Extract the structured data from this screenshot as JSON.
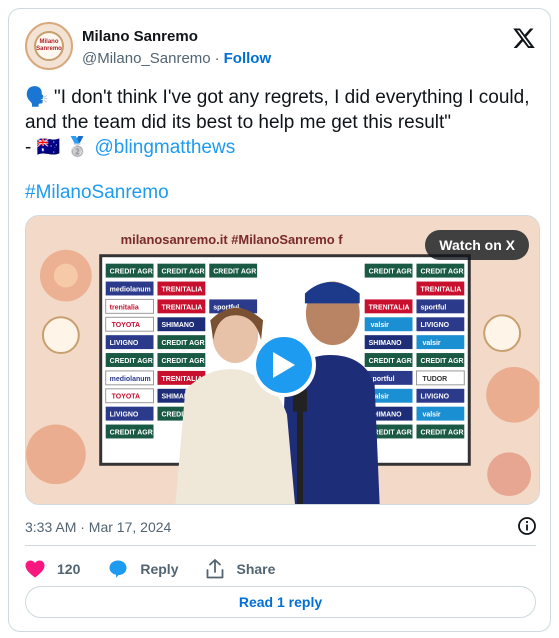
{
  "author": {
    "name": "Milano Sanremo",
    "handle": "@Milano_Sanremo",
    "separator": "·",
    "follow_label": "Follow",
    "avatar_text": "Milano Sanremo"
  },
  "tweet": {
    "quote_emoji": "🗣️",
    "text": " \"I don't think I've got any regrets, I did everything I could, and the team did its best to help me get this result\"",
    "dash": "- 🇦🇺 🥈 ",
    "mention": "@blingmatthews",
    "hashtag": "#MilanoSanremo"
  },
  "media": {
    "watch_label": "Watch on X",
    "banner_text": "milanosanremo.it  #MilanoSanremo",
    "sponsor_logos": [
      "CREDIT AGRICOLE",
      "TUDOR",
      "sportful",
      "TRENITALIA",
      "SHIMANO",
      "valsir",
      "LIVIGNO",
      "TOYOTA",
      "Mediolanum"
    ]
  },
  "meta": {
    "timestamp": "3:33 AM · Mar 17, 2024"
  },
  "actions": {
    "likes": "120",
    "reply_label": "Reply",
    "share_label": "Share",
    "read_reply_label": "Read 1 reply"
  },
  "colors": {
    "link": "#1d9bf0",
    "follow": "#006fd6",
    "like": "#f91880"
  }
}
